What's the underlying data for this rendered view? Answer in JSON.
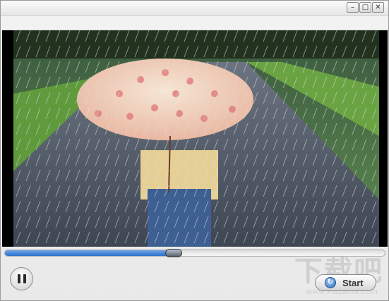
{
  "window": {
    "controls": [
      {
        "name": "minimize",
        "glyph": "–"
      },
      {
        "name": "maximize",
        "glyph": "□"
      },
      {
        "name": "close",
        "glyph": "✕"
      }
    ]
  },
  "player": {
    "progress_percent": 44.5,
    "pause_icon": "pause-icon",
    "start_label": "Start",
    "start_icon": "refresh-icon"
  },
  "watermark": {
    "big": "下载吧",
    "small": "www.xiazaiba.com"
  },
  "colors": {
    "progress_fill": "#2a6fcb",
    "video_bg": "#000000"
  }
}
